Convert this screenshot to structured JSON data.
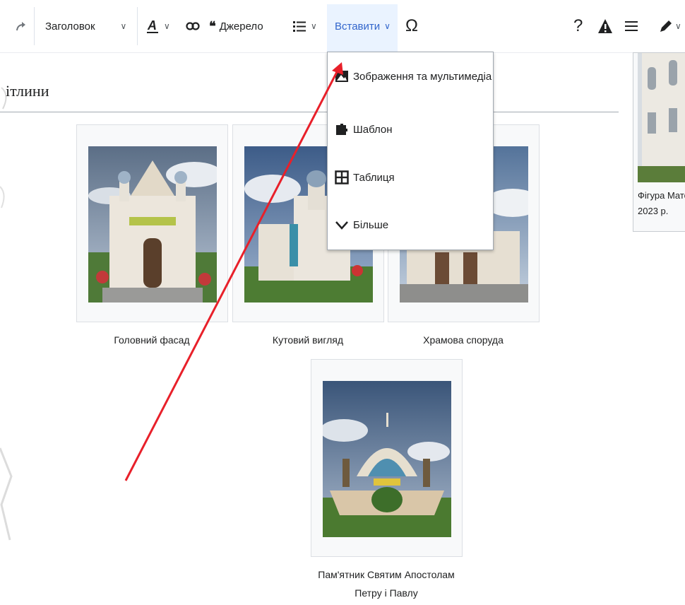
{
  "toolbar": {
    "format_label": "Заголовок",
    "source_label": "Джерело",
    "insert_label": "Вставити",
    "help_glyph": "?",
    "special_glyph": "Ω"
  },
  "insert_menu": {
    "items": [
      {
        "label": "Зображення та мультимедіа",
        "icon": "image-icon"
      },
      {
        "label": "Шаблон",
        "icon": "puzzle-icon"
      },
      {
        "label": "Таблиця",
        "icon": "table-icon"
      },
      {
        "label": "Більше",
        "icon": "chevron-down-icon"
      }
    ]
  },
  "section": {
    "heading": "ітлини"
  },
  "gallery": [
    {
      "caption": "Головний фасад"
    },
    {
      "caption": "Кутовий вигляд"
    },
    {
      "caption": "Храмова споруда"
    },
    {
      "caption": "Пам'ятник Святим Апостолам Петру і Павлу"
    }
  ],
  "side_image": {
    "caption_line1": "Фігура Мате",
    "caption_line2": "2023 р."
  },
  "colors": {
    "accent": "#3366cc",
    "annotation_arrow": "#e8202a",
    "active_bg": "#eaf3ff"
  }
}
